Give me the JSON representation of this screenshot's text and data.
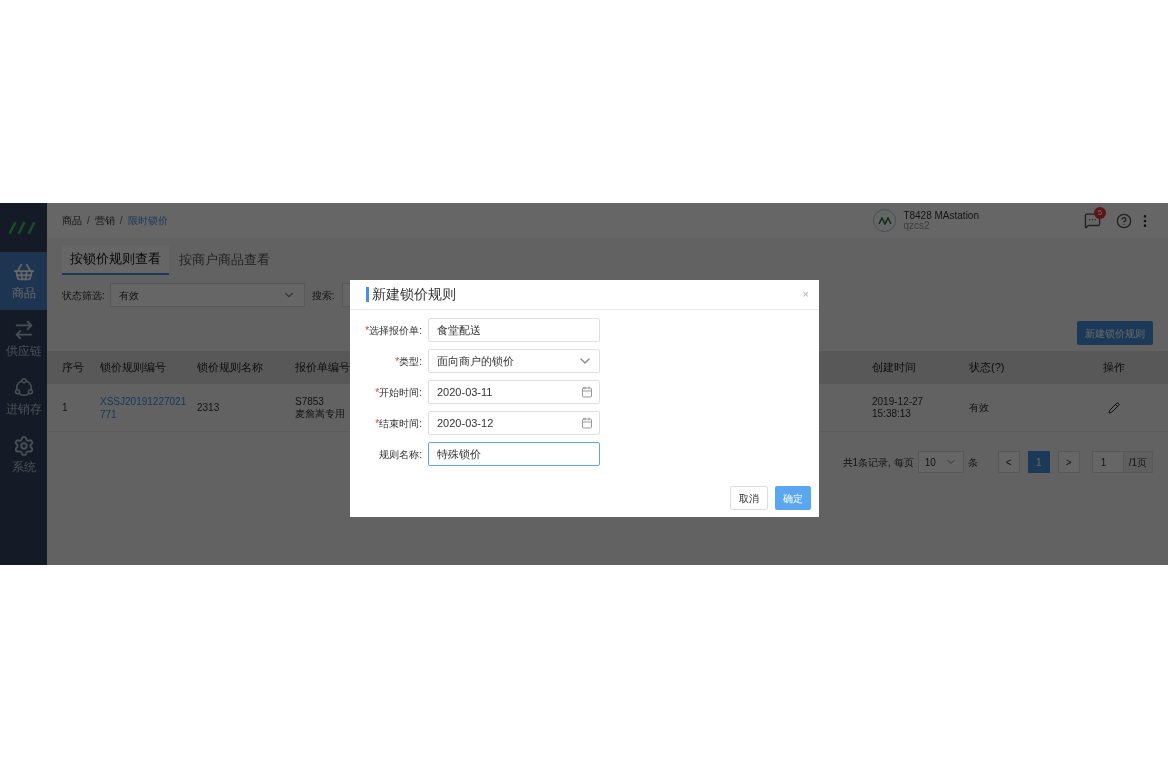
{
  "sidebar": {
    "items": [
      {
        "label": "商品",
        "kind": "bag",
        "selected": true
      },
      {
        "label": "供应链",
        "kind": "swap",
        "selected": false
      },
      {
        "label": "进销存",
        "kind": "nodes",
        "selected": false
      },
      {
        "label": "系统",
        "kind": "gear",
        "selected": false
      }
    ]
  },
  "breadcrumb": [
    {
      "label": "商品",
      "current": false
    },
    {
      "label": "营销",
      "current": false
    },
    {
      "label": "限时锁价",
      "current": true
    }
  ],
  "breadcrumb_separator": "/",
  "account": {
    "name": "T8428 MAstation",
    "id": "qzcs2"
  },
  "notifications": {
    "count": "5"
  },
  "tabs": [
    {
      "label": "按锁价规则查看",
      "selected": true
    },
    {
      "label": "按商户商品查看",
      "selected": false
    }
  ],
  "filters": {
    "status_label": "状态筛选:",
    "status_value": "有效",
    "search_label": "搜索:"
  },
  "new_button": "新建锁价规则",
  "table": {
    "columns": [
      "序号",
      "锁价规则编号",
      "锁价规则名称",
      "报价单编号",
      "创建时间",
      "状态(?)",
      "操作"
    ],
    "rows": [
      {
        "index": "1",
        "code": "XSSJ20191227021771",
        "name": "2313",
        "quote": [
          "S7853",
          "麦詹嵩专用"
        ],
        "created": "2019-12-27 15:38:13",
        "status": "有效"
      }
    ]
  },
  "pagination": {
    "summary": "共1条记录, 每页",
    "page_size": "10",
    "unit": "条",
    "prev": "<",
    "pages": [
      {
        "label": "1",
        "selected": true
      }
    ],
    "next": ">",
    "jump_value": "1",
    "total": "/1页"
  },
  "modal": {
    "title": "新建锁价规则",
    "close": "×",
    "fields": [
      {
        "label": "选择报价单:",
        "required_mark": "*",
        "kind": "text",
        "value": "食堂配送",
        "focused": false
      },
      {
        "label": "类型:",
        "required_mark": "*",
        "kind": "select",
        "value": "面向商户的锁价",
        "focused": false
      },
      {
        "label": "开始时间:",
        "required_mark": "*",
        "kind": "date",
        "value": "2020-03-11",
        "focused": false
      },
      {
        "label": "结束时间:",
        "required_mark": "*",
        "kind": "date",
        "value": "2020-03-12",
        "focused": false
      },
      {
        "label": "规则名称:",
        "kind": "text",
        "value": "特殊锁价",
        "focused": true
      }
    ],
    "buttons": [
      {
        "label": "取消",
        "primary": false
      },
      {
        "label": "确定",
        "primary": true
      }
    ]
  }
}
